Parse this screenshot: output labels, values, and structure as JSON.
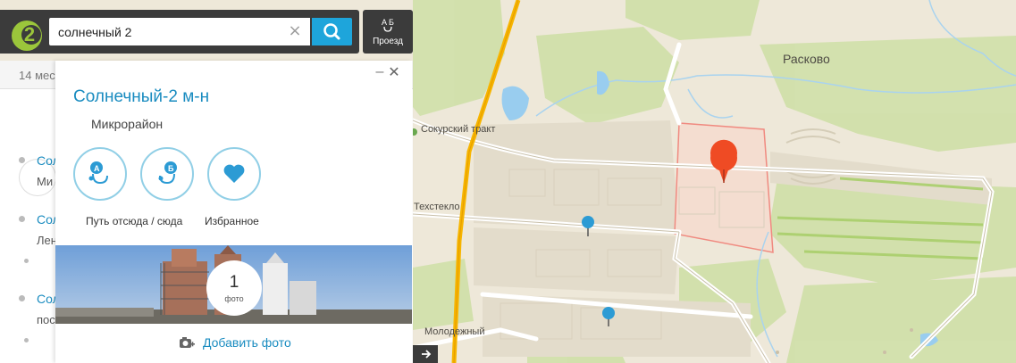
{
  "search": {
    "query": "солнечный 2",
    "placeholder": ""
  },
  "logo": {
    "text": "2"
  },
  "route_button": {
    "label": "Проезд",
    "icon": "route-ab-icon"
  },
  "list": {
    "header": "14 мес",
    "items": [
      {
        "title": "Сол",
        "subtitle": "Ми"
      },
      {
        "title": "Сол",
        "subtitle": "Лен"
      },
      {
        "title": "Сол",
        "subtitle": "пос"
      }
    ]
  },
  "card": {
    "title": "Солнечный-2 м-н",
    "type": "Микрорайон",
    "actions": [
      {
        "label": "Путь отсюда / сюда",
        "icon": "route-from-to-icon"
      },
      {
        "label": "Избранное",
        "icon": "heart-icon"
      }
    ],
    "photo_count": "1",
    "photo_count_label": "фото",
    "add_photo_label": "Добавить фото",
    "minimize_symbol": "–",
    "close_symbol": "✕"
  },
  "map_labels": {
    "raskovo": "Расково",
    "sokursky": "Сокурский тракт",
    "tekhsteklo": "Техстекло",
    "molodezhny": "Молодежный"
  },
  "colors": {
    "accent": "#1ea5db",
    "brand_green": "#9bc63b",
    "dark_bar": "#3b3b3b",
    "link_blue": "#1a8cc0",
    "marker_red": "#ef4b24",
    "marker_blue": "#2c9bd4",
    "area_outline": "#f08a80"
  }
}
